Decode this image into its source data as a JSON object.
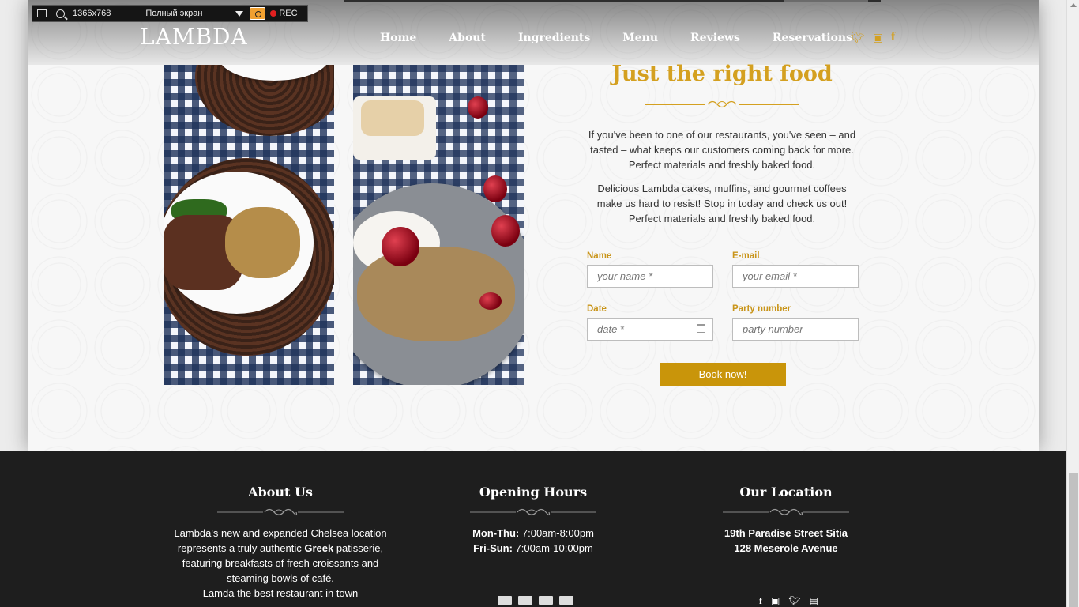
{
  "recorder": {
    "resolution": "1366x768",
    "mode": "Полный экран",
    "rec_label": "REC"
  },
  "header": {
    "logo": "LAMBDA",
    "nav": [
      "Home",
      "About",
      "Ingredients",
      "Menu",
      "Reviews",
      "Reservations"
    ],
    "social_icons": [
      "twitter-icon",
      "youtube-icon",
      "facebook-icon"
    ]
  },
  "section": {
    "title": "Just the right food",
    "paragraph1": "If you've been to one of our restaurants, you've seen – and tasted – what keeps our customers coming back for more. Perfect materials and freshly baked food.",
    "paragraph2": "Delicious Lambda cakes, muffins, and gourmet coffees make us hard to resist! Stop in today and check us out! Perfect materials and freshly baked food."
  },
  "form": {
    "name_label": "Name",
    "name_placeholder": "your name *",
    "email_label": "E-mail",
    "email_placeholder": "your email *",
    "date_label": "Date",
    "date_placeholder": "date *",
    "party_label": "Party number",
    "party_placeholder": "party number",
    "submit_label": "Book now!"
  },
  "footer": {
    "about": {
      "title": "About Us",
      "line1": "Lambda's new and expanded Chelsea location",
      "line2_pre": "represents a truly authentic ",
      "line2_bold": "Greek",
      "line2_post": " patisserie,",
      "line3": "featuring breakfasts of fresh croissants and",
      "line4": "steaming bowls of café.",
      "line5": "Lamda the best restaurant in town"
    },
    "hours": {
      "title": "Opening Hours",
      "row1_label": "Mon-Thu:",
      "row1_value": " 7:00am-8:00pm",
      "row2_label": "Fri-Sun:",
      "row2_value": " 7:00am-10:00pm"
    },
    "location": {
      "title": "Our Location",
      "line1": "19th Paradise Street Sitia",
      "line2": "128 Meserole Avenue"
    },
    "payment_icons": [
      "credit-card-icon",
      "paypal-icon",
      "visa-icon",
      "discover-icon"
    ],
    "social_icons": [
      "facebook-icon",
      "youtube-icon",
      "twitter-icon",
      "tumblr-icon"
    ]
  },
  "colors": {
    "accent": "#c9950a",
    "footer_bg": "#1e1e1e"
  }
}
